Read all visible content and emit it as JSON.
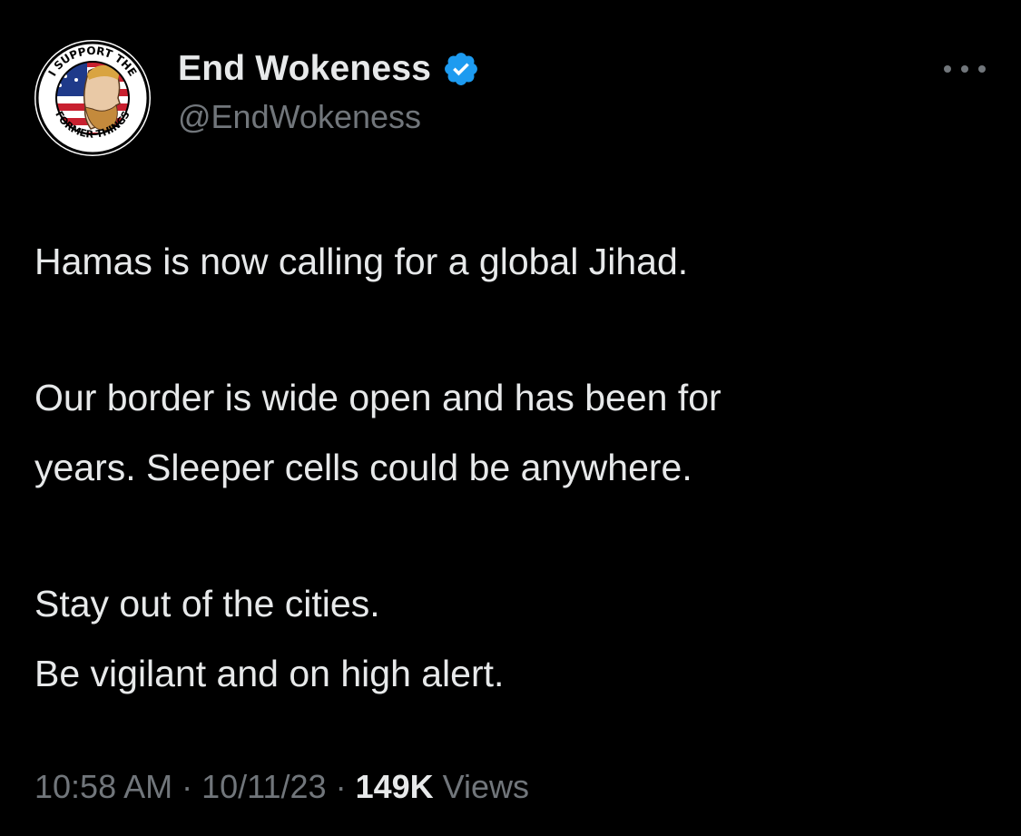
{
  "author": {
    "display_name": "End Wokeness",
    "handle": "@EndWokeness",
    "verified_icon": "verified-badge-icon",
    "avatar": {
      "description_icon": "avatar-badge-icon",
      "ring_text_top": "I SUPPORT THE",
      "ring_text_bottom": "FORMER THINGS"
    }
  },
  "menu": {
    "icon": "more-options-icon"
  },
  "tweet": {
    "paragraphs": [
      [
        "Hamas is now calling for a global Jihad."
      ],
      [
        "Our border is wide open and has been for",
        "years. Sleeper cells could be anywhere."
      ],
      [
        "Stay out of the cities.",
        "Be vigilant and on high alert."
      ]
    ]
  },
  "meta": {
    "time": "10:58 AM",
    "separator": "·",
    "date": "10/11/23",
    "views_count": "149K",
    "views_label": "Views"
  },
  "colors": {
    "background": "#000000",
    "text_primary": "#e7e9ea",
    "text_secondary": "#71767b",
    "verified_blue": "#1d9bf0"
  }
}
